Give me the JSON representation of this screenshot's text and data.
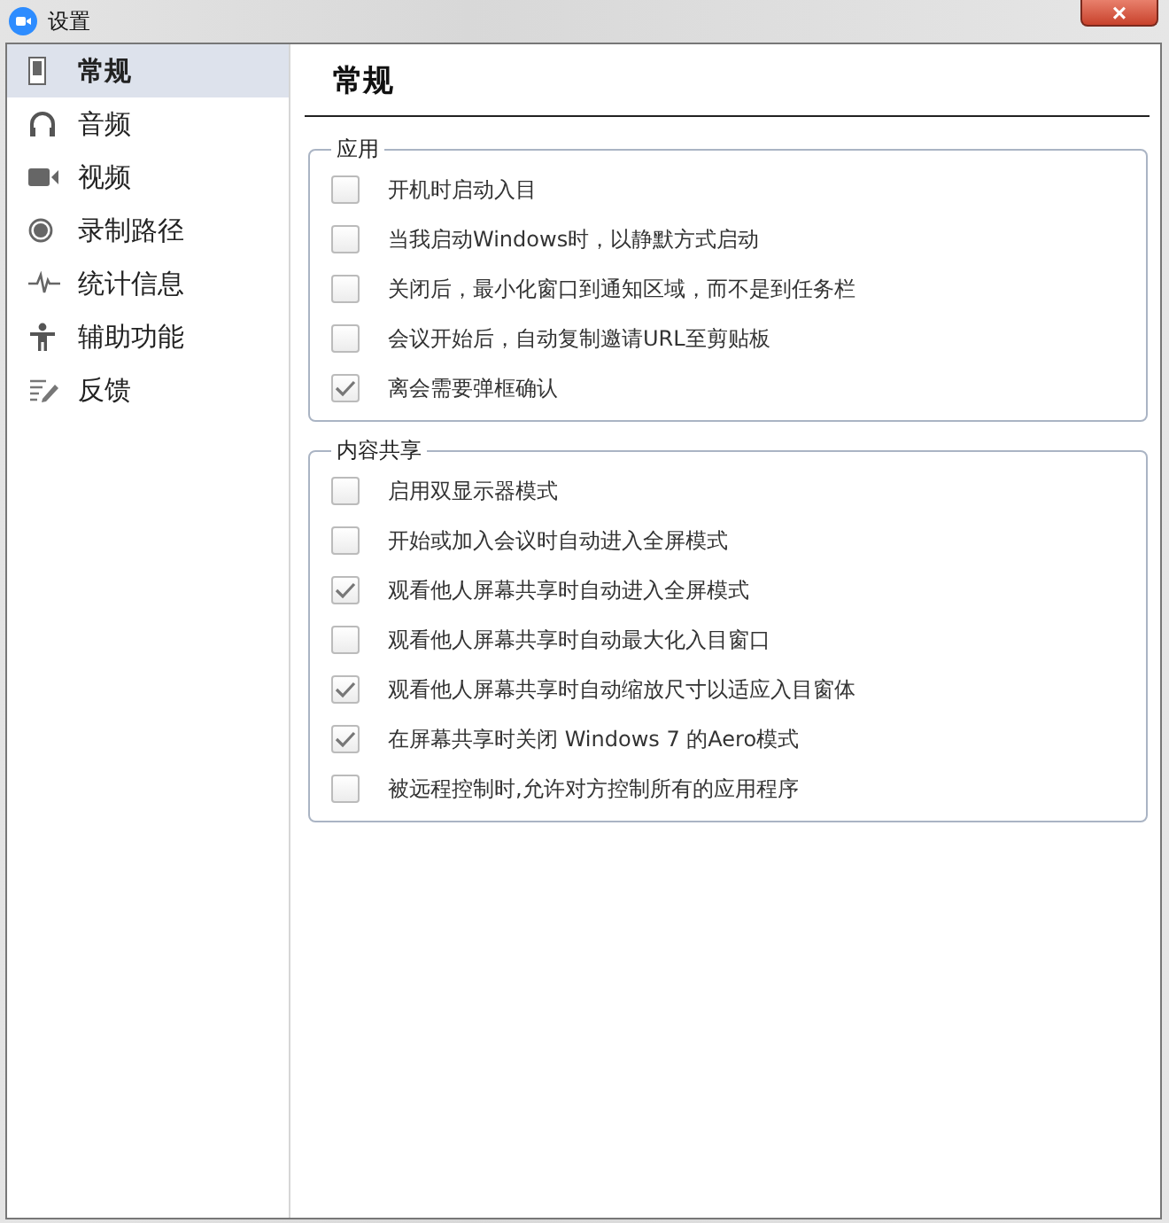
{
  "window": {
    "title": "设置",
    "close": "×"
  },
  "sidebar": {
    "items": [
      {
        "kind": "phone",
        "label": "常规",
        "selected": true
      },
      {
        "kind": "headphones",
        "label": "音频",
        "selected": false
      },
      {
        "kind": "camera",
        "label": "视频",
        "selected": false
      },
      {
        "kind": "record",
        "label": "录制路径",
        "selected": false
      },
      {
        "kind": "pulse",
        "label": "统计信息",
        "selected": false
      },
      {
        "kind": "person",
        "label": "辅助功能",
        "selected": false
      },
      {
        "kind": "pen",
        "label": "反馈",
        "selected": false
      }
    ]
  },
  "heading": "常规",
  "groups": [
    {
      "title": "应用",
      "options": [
        {
          "label": "开机时启动入目",
          "checked": false
        },
        {
          "label": "当我启动Windows时，以静默方式启动",
          "checked": false
        },
        {
          "label": "关闭后，最小化窗口到通知区域，而不是到任务栏",
          "checked": false
        },
        {
          "label": "会议开始后，自动复制邀请URL至剪贴板",
          "checked": false
        },
        {
          "label": "离会需要弹框确认",
          "checked": true
        }
      ]
    },
    {
      "title": "内容共享",
      "options": [
        {
          "label": "启用双显示器模式",
          "checked": false
        },
        {
          "label": "开始或加入会议时自动进入全屏模式",
          "checked": false
        },
        {
          "label": "观看他人屏幕共享时自动进入全屏模式",
          "checked": true
        },
        {
          "label": "观看他人屏幕共享时自动最大化入目窗口",
          "checked": false
        },
        {
          "label": "观看他人屏幕共享时自动缩放尺寸以适应入目窗体",
          "checked": true
        },
        {
          "label": "在屏幕共享时关闭 Windows 7 的Aero模式",
          "checked": true
        },
        {
          "label": "被远程控制时,允许对方控制所有的应用程序",
          "checked": false
        }
      ]
    }
  ]
}
